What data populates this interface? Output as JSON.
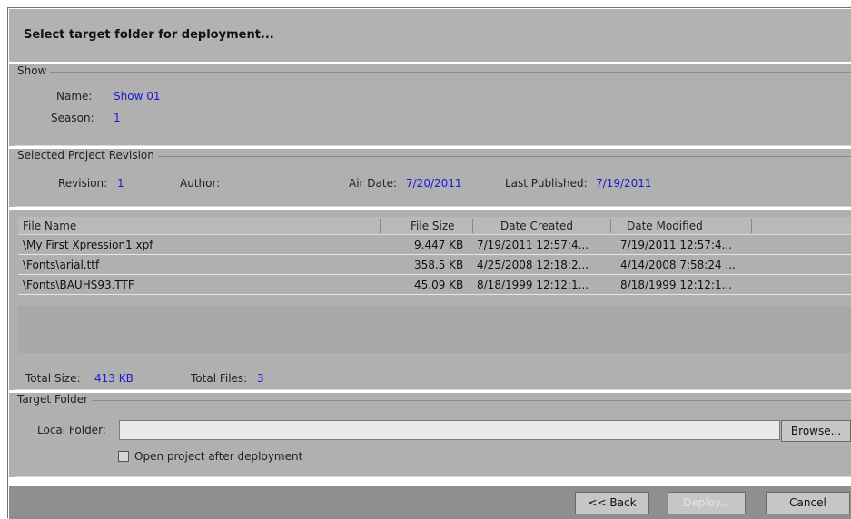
{
  "dialog": {
    "title": "Select target folder for deployment..."
  },
  "show": {
    "legend": "Show",
    "name_label": "Name:",
    "name_value": "Show 01",
    "season_label": "Season:",
    "season_value": "1"
  },
  "revision": {
    "legend": "Selected Project Revision",
    "revision_label": "Revision:",
    "revision_value": "1",
    "author_label": "Author:",
    "author_value": "",
    "air_date_label": "Air Date:",
    "air_date_value": "7/20/2011",
    "last_published_label": "Last Published:",
    "last_published_value": "7/19/2011"
  },
  "files": {
    "columns": [
      "File Name",
      "File Size",
      "Date Created",
      "Date Modified"
    ],
    "rows": [
      [
        "\\My First Xpression1.xpf",
        "9.447 KB",
        "7/19/2011 12:57:4...",
        "7/19/2011 12:57:4..."
      ],
      [
        "\\Fonts\\arial.ttf",
        "358.5 KB",
        "4/25/2008 12:18:2...",
        "4/14/2008 7:58:24 ..."
      ],
      [
        "\\Fonts\\BAUHS93.TTF",
        "45.09 KB",
        "8/18/1999 12:12:1...",
        "8/18/1999 12:12:1..."
      ]
    ],
    "total_size_label": "Total Size:",
    "total_size_value": "413 KB",
    "total_files_label": "Total Files:",
    "total_files_value": "3"
  },
  "target": {
    "legend": "Target Folder",
    "local_folder_label": "Local Folder:",
    "local_folder_value": "",
    "browse_label": "Browse...",
    "open_project_label": "Open project after deployment",
    "open_project_checked": false
  },
  "footer": {
    "back_label": "<< Back",
    "deploy_label": "Deploy...",
    "cancel_label": "Cancel"
  }
}
